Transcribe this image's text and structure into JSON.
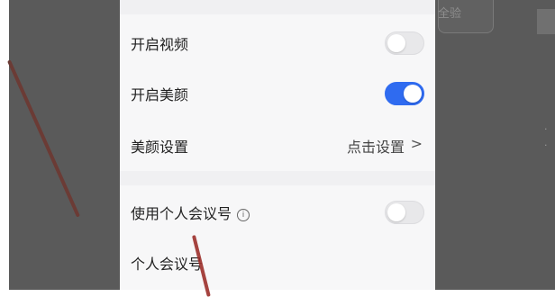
{
  "background": {
    "color": "#5a5a5a",
    "right_text": "全验"
  },
  "settings": {
    "rows": [
      {
        "label": "开启视频",
        "toggle_on": false
      },
      {
        "label": "开启美颜",
        "toggle_on": true
      },
      {
        "label": "美颜设置",
        "value": "点击设置",
        "chevron": ">"
      },
      {
        "label": "使用个人会议号",
        "info": "i",
        "toggle_on": false
      },
      {
        "label": "个人会议号"
      }
    ]
  },
  "colors": {
    "toggle_on": "#2f6bf0",
    "toggle_off": "#e8e8ea",
    "panel_bg": "#f7f7f8"
  }
}
